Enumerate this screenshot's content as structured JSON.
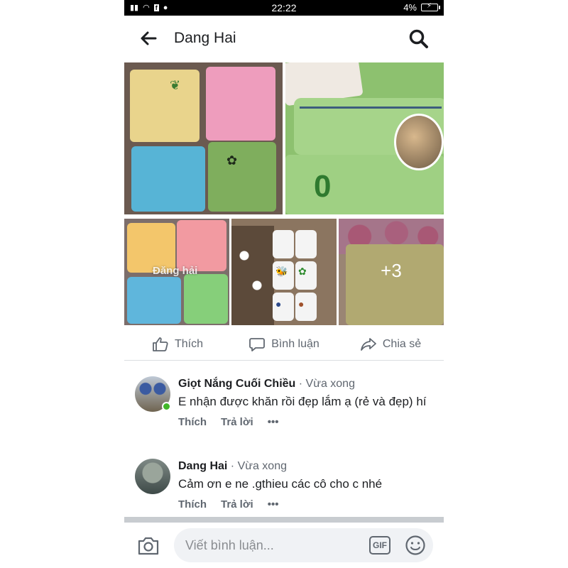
{
  "status_bar": {
    "time": "22:22",
    "battery": "4%"
  },
  "header": {
    "title": "Dang Hai",
    "back_icon": "arrow-left-icon",
    "search_icon": "search-icon"
  },
  "photos": {
    "caption": "Đăng hải",
    "more_count": "+3",
    "numeral": "0"
  },
  "actions": {
    "like": "Thích",
    "comment": "Bình luận",
    "share": "Chia sẻ"
  },
  "comments": [
    {
      "author": "Giọt Nắng Cuối Chiều",
      "time": "· Vừa xong",
      "text": "E nhận được khăn rồi đẹp lắm ạ (rẻ và đẹp) hí",
      "like": "Thích",
      "reply": "Trả lời",
      "more": "•••",
      "online": true
    },
    {
      "author": "Dang Hai",
      "time": "· Vừa xong",
      "text": "Cảm  ơn e ne  .gthieu  các  cô cho c nhé",
      "like": "Thích",
      "reply": "Trả lời",
      "more": "•••",
      "online": false
    }
  ],
  "composer": {
    "placeholder": "Viết bình luận...",
    "gif_label": "GIF",
    "camera_icon": "camera-icon",
    "emoji_icon": "emoji-icon"
  },
  "colors": {
    "accent_text": "#1c1e21",
    "secondary_text": "#606770",
    "online_green": "#42b72a"
  }
}
